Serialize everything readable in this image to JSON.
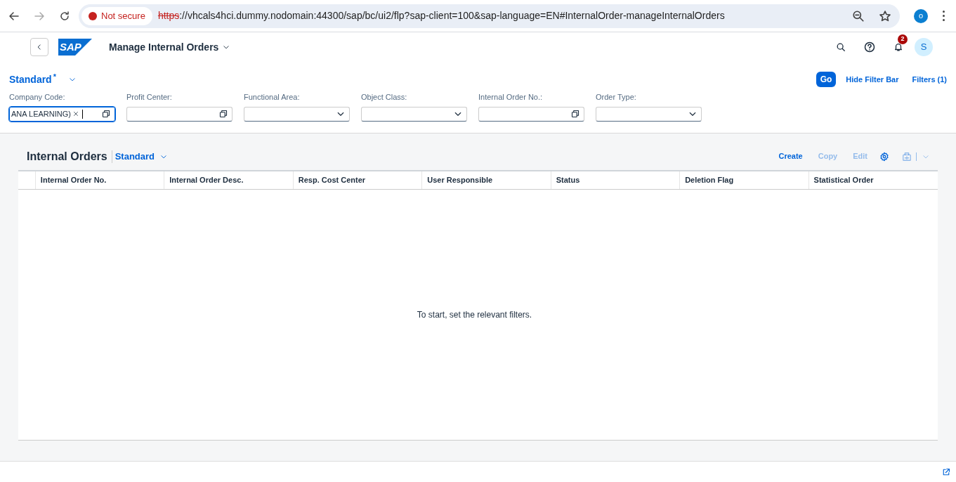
{
  "browser": {
    "security_label": "Not secure",
    "url_scheme": "https",
    "url_rest": "://vhcals4hci.dummy.nodomain:44300/sap/bc/ui2/flp?sap-client=100&sap-language=EN#InternalOrder-manageInternalOrders",
    "profile_initial": "o"
  },
  "shell": {
    "logo_text": "SAP",
    "app_title": "Manage Internal Orders",
    "notification_count": "2",
    "user_initial": "S"
  },
  "filter_bar": {
    "variant": "Standard",
    "variant_modified_mark": "*",
    "go": "Go",
    "hide": "Hide Filter Bar",
    "filters": "Filters (1)",
    "fields": [
      {
        "label": "Company Code:",
        "kind": "valuehelp",
        "token": "ANA LEARNING)",
        "focused": true
      },
      {
        "label": "Profit Center:",
        "kind": "valuehelp",
        "focused": false
      },
      {
        "label": "Functional Area:",
        "kind": "select",
        "focused": false
      },
      {
        "label": "Object Class:",
        "kind": "select",
        "focused": false
      },
      {
        "label": "Internal Order No.:",
        "kind": "valuehelp",
        "focused": false
      },
      {
        "label": "Order Type:",
        "kind": "select",
        "focused": false
      }
    ]
  },
  "table": {
    "title": "Internal Orders",
    "variant": "Standard",
    "actions": [
      {
        "label": "Create",
        "disabled": false
      },
      {
        "label": "Copy",
        "disabled": true
      },
      {
        "label": "Edit",
        "disabled": true
      }
    ],
    "columns": [
      "Internal Order No.",
      "Internal Order Desc.",
      "Resp. Cost Center",
      "User Responsible",
      "Status",
      "Deletion Flag",
      "Statistical Order"
    ],
    "empty_text": "To start, set the relevant filters."
  }
}
